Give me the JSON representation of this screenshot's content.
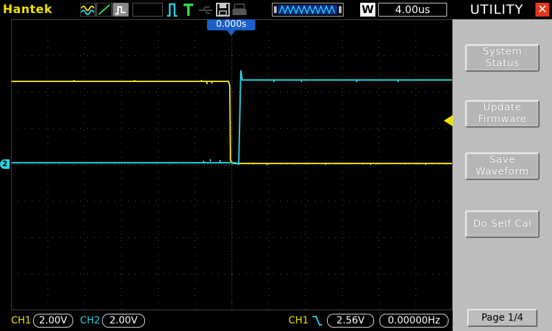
{
  "brand": "Hantek",
  "header": {
    "timebase": "4.00us",
    "mode_letter": "W",
    "trigger_position": "0.000s"
  },
  "panel": {
    "title": "UTILITY",
    "close_icon": "close-icon",
    "buttons": [
      {
        "label": "System\nStatus"
      },
      {
        "label": "Update\nFirmware"
      },
      {
        "label": "Save\nWaveform"
      },
      {
        "label": "Do Self Cal"
      }
    ],
    "page": "Page 1/4"
  },
  "channels": {
    "ch1_label": "CH1",
    "ch1_scale": "2.00V",
    "ch2_label": "CH2",
    "ch2_scale": "2.00V",
    "ch1_color": "#f0e000",
    "ch2_color": "#2ad0e0",
    "ground_marker": "2"
  },
  "trigger": {
    "source": "CH1",
    "edge_icon": "falling-edge-icon",
    "level": "2.56V",
    "frequency": "0.00000Hz"
  },
  "icons": [
    "sine-wave-icon",
    "line-icon",
    "waveform-box-icon",
    "trigger-pulse-icon",
    "trigger-t-icon",
    "usb-icon",
    "floppy-save-icon",
    "printer-icon",
    "waveform-memory-icon"
  ]
}
